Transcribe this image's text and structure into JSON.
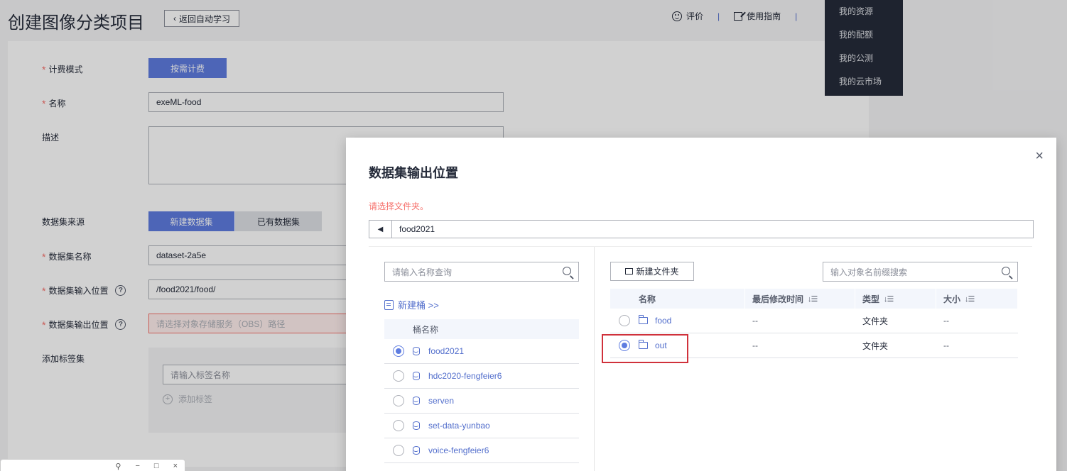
{
  "page": {
    "title": "创建图像分类项目",
    "back_label": "返回自动学习",
    "top_links": {
      "rate": "评价",
      "guide": "使用指南",
      "sep": "|"
    }
  },
  "dropdown_menu": {
    "items": [
      "我的资源",
      "我的配额",
      "我的公测",
      "我的云市场"
    ]
  },
  "form": {
    "billing": {
      "label": "计费模式",
      "value": "按需计费"
    },
    "name": {
      "label": "名称",
      "value": "exeML-food"
    },
    "desc": {
      "label": "描述"
    },
    "source": {
      "label": "数据集来源",
      "opt_new": "新建数据集",
      "opt_existing": "已有数据集"
    },
    "dataset_name": {
      "label": "数据集名称",
      "value": "dataset-2a5e"
    },
    "input": {
      "label": "数据集输入位置",
      "value": "/food2021/food/"
    },
    "output": {
      "label": "数据集输出位置",
      "placeholder": "请选择对象存储服务（OBS）路径"
    },
    "tags": {
      "label": "添加标签集",
      "placeholder": "请输入标签名称",
      "add": "添加标签"
    },
    "required_mark": "*",
    "help_mark": "?"
  },
  "modal": {
    "title": "数据集输出位置",
    "hint": "请选择文件夹。",
    "path": "food2021",
    "close": "×",
    "left": {
      "search_placeholder": "请输入名称查询",
      "new_bucket": "新建桶 >>",
      "column": "桶名称",
      "buckets": [
        {
          "name": "food2021",
          "selected": true
        },
        {
          "name": "hdc2020-fengfeier6",
          "selected": false
        },
        {
          "name": "serven",
          "selected": false
        },
        {
          "name": "set-data-yunbao",
          "selected": false
        },
        {
          "name": "voice-fengfeier6",
          "selected": false
        }
      ]
    },
    "right": {
      "new_folder": "新建文件夹",
      "search_placeholder": "输入对象名前缀搜索",
      "columns": {
        "name": "名称",
        "time": "最后修改时间",
        "type": "类型",
        "size": "大小"
      },
      "rows": [
        {
          "name": "food",
          "time": "--",
          "type": "文件夹",
          "size": "--",
          "selected": false
        },
        {
          "name": "out",
          "time": "--",
          "type": "文件夹",
          "size": "--",
          "selected": true
        }
      ]
    }
  },
  "colors": {
    "primary": "#5e7ce0",
    "link": "#526ecc",
    "error": "#f66f6a",
    "highlight": "#d0313b"
  }
}
